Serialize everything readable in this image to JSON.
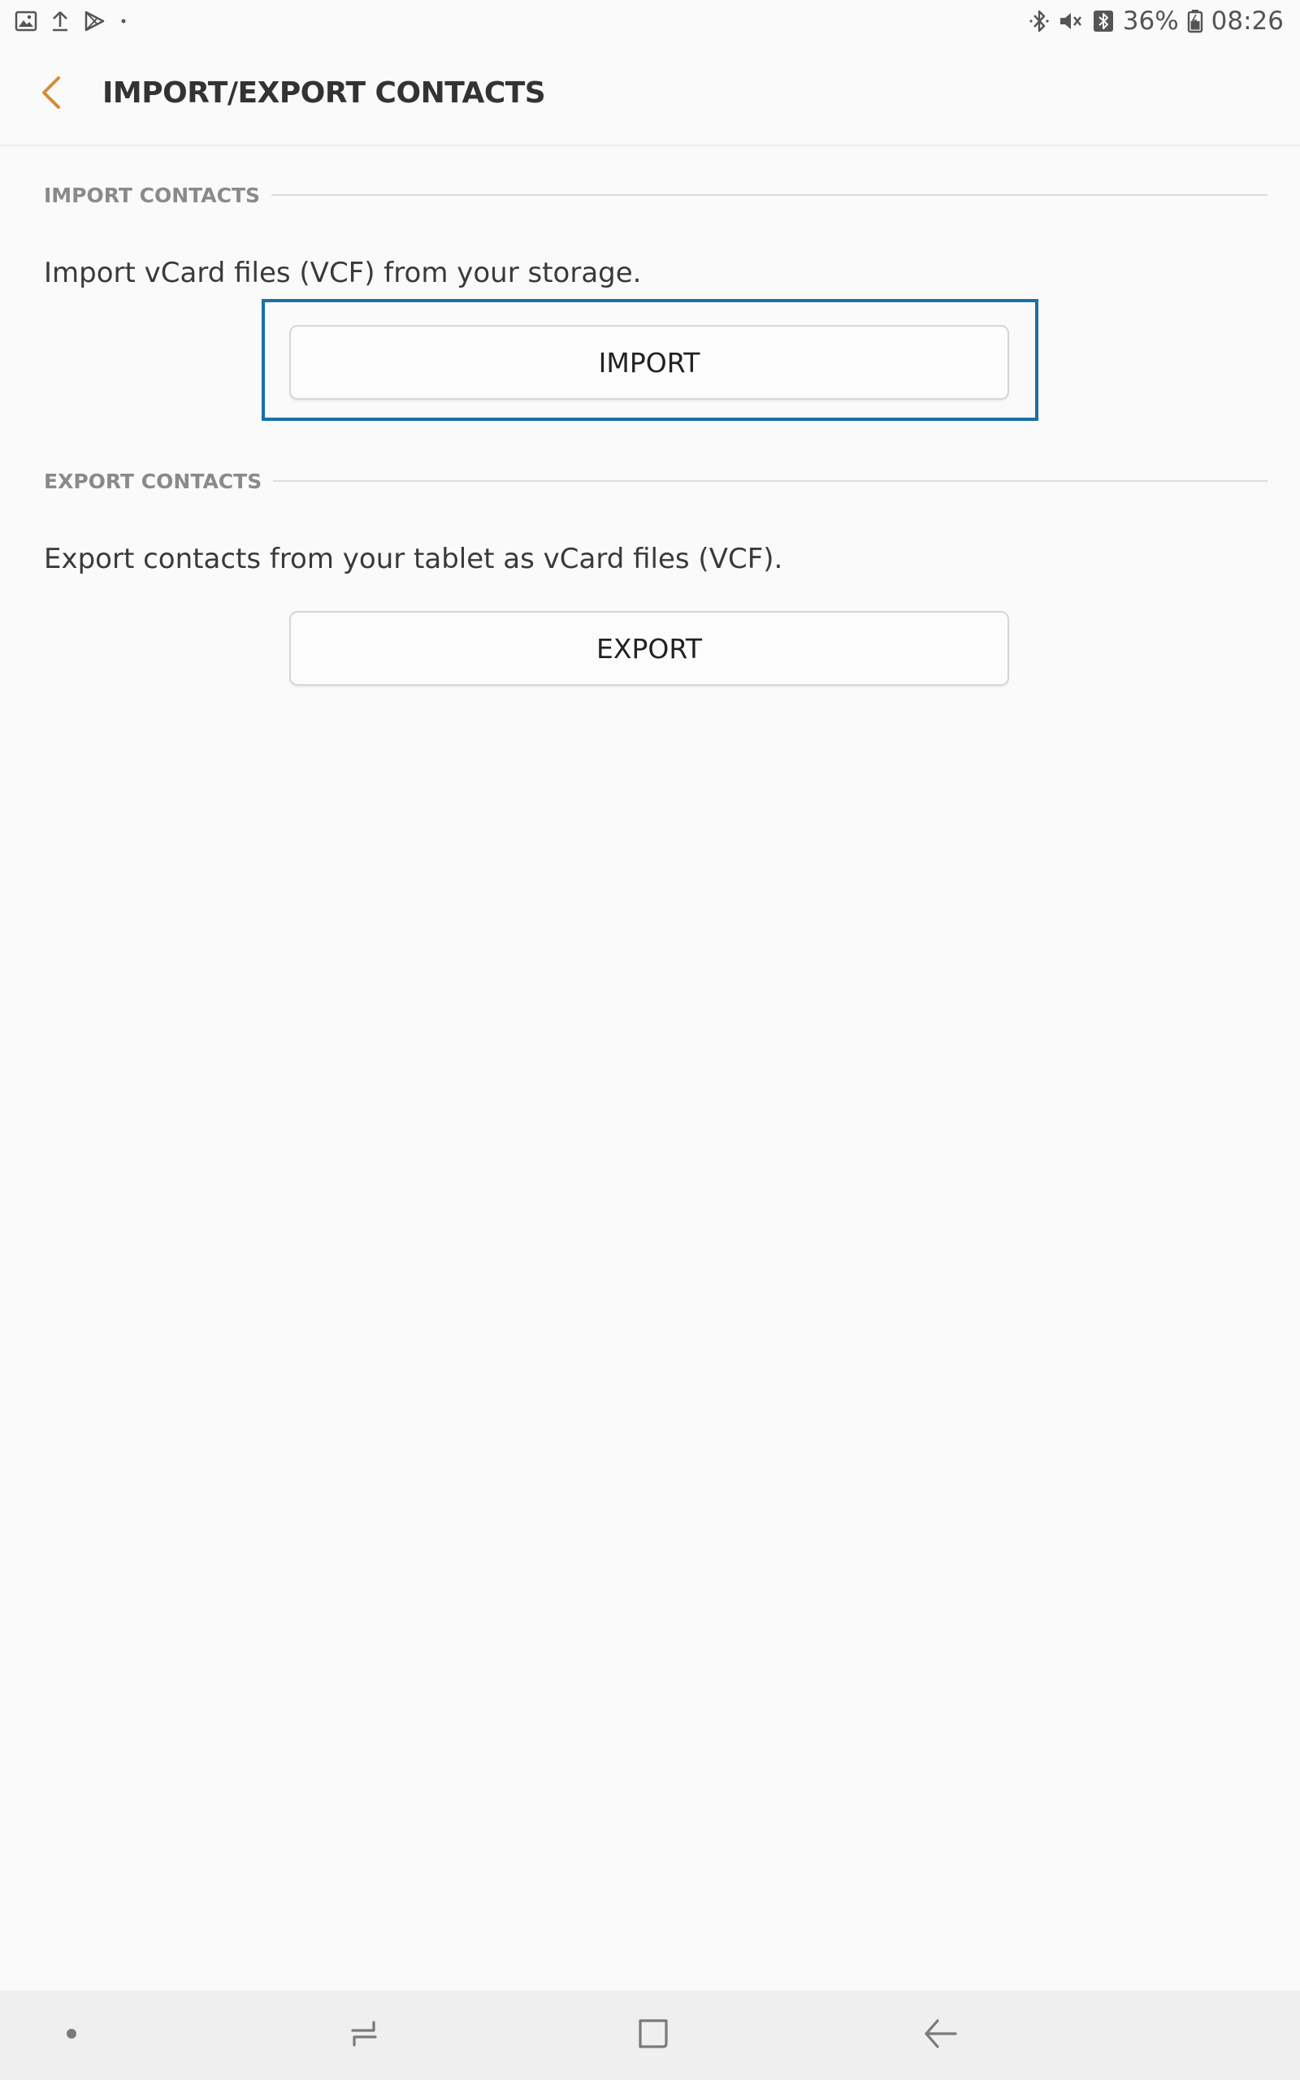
{
  "status_bar": {
    "battery_percent": "36%",
    "time": "08:26",
    "left_icons": [
      "gallery-icon",
      "upload-icon",
      "play-store-icon",
      "dot-icon"
    ],
    "right_icons": [
      "bluetooth-icon",
      "mute-icon",
      "bluetooth-box-icon",
      "battery-icon"
    ]
  },
  "app_bar": {
    "title": "IMPORT/EXPORT CONTACTS",
    "back_icon": "chevron-left-icon",
    "accent_color": "#d7893a"
  },
  "import_section": {
    "header": "IMPORT CONTACTS",
    "description": "Import vCard files (VCF) from your storage.",
    "button_label": "IMPORT",
    "focused": true,
    "focus_color": "#1a6fa6"
  },
  "export_section": {
    "header": "EXPORT CONTACTS",
    "description": "Export contacts from your tablet as vCard files (VCF).",
    "button_label": "EXPORT"
  },
  "nav_bar": {
    "buttons": [
      "dot-icon",
      "recents-icon",
      "home-icon",
      "back-arrow-icon"
    ]
  }
}
